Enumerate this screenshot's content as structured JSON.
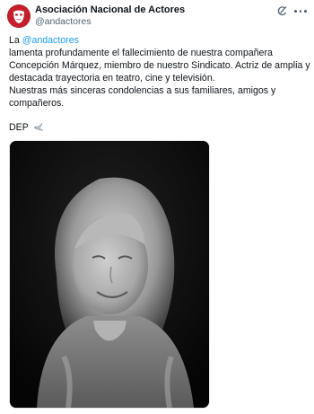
{
  "author": {
    "display_name": "Asociación Nacional de Actores",
    "handle": "@andactores",
    "avatar_icon": "theatre-mask-icon",
    "avatar_color": "#c4202b"
  },
  "actions": {
    "grok_icon": "grok-icon",
    "more_icon": "more-dots-icon"
  },
  "post": {
    "line1_prefix": "La ",
    "mention": "@andactores",
    "lines": [
      "lamenta profundamente el fallecimiento de nuestra compañera",
      "Concepción Márquez, miembro de nuestro Sindicato. Actriz de amplia y",
      "destacada trayectoria en teatro, cine y televisión.",
      "Nuestras más sinceras condolencias a sus familiares, amigos y",
      "compañeros."
    ],
    "dep": "DEP",
    "dep_icon": "dove-icon",
    "mention_color": "#1d9bf0"
  },
  "media": {
    "type": "black-and-white portrait photo"
  }
}
